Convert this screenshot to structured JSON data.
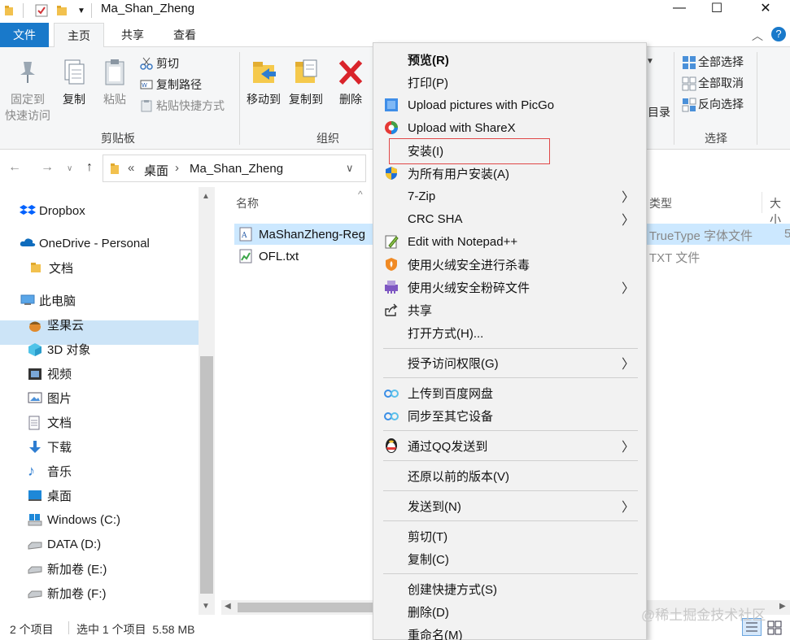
{
  "window": {
    "title": "Ma_Shan_Zheng",
    "controls": {
      "minimize": "—",
      "maximize": "☐",
      "close": "✕"
    }
  },
  "ribbon_tabs": [
    "文件",
    "主页",
    "共享",
    "查看"
  ],
  "ribbon": {
    "clipboard": {
      "pin": "固定到",
      "pin2": "快速访问",
      "copy": "复制",
      "paste": "粘贴",
      "cut": "剪切",
      "copy_path": "复制路径",
      "paste_shortcut": "粘贴快捷方式",
      "group": "剪贴板"
    },
    "organize": {
      "move_to": "移动到",
      "copy_to": "复制到",
      "delete": "删除",
      "group": "组织"
    },
    "open_partial": "目录",
    "select": {
      "select_all": "全部选择",
      "select_none": "全部取消",
      "invert": "反向选择",
      "group": "选择"
    }
  },
  "address": {
    "prefix": "«",
    "crumb1": "桌面",
    "sep": "›",
    "crumb2": "Ma_Shan_Zheng"
  },
  "sidebar": {
    "items": [
      {
        "label": "Dropbox"
      },
      {
        "label": "OneDrive - Personal"
      },
      {
        "label": "文档"
      },
      {
        "label": "此电脑"
      },
      {
        "label": "坚果云"
      },
      {
        "label": "3D 对象"
      },
      {
        "label": "视频"
      },
      {
        "label": "图片"
      },
      {
        "label": "文档"
      },
      {
        "label": "下载"
      },
      {
        "label": "音乐"
      },
      {
        "label": "桌面"
      },
      {
        "label": "Windows (C:)"
      },
      {
        "label": "DATA (D:)"
      },
      {
        "label": "新加卷 (E:)"
      },
      {
        "label": "新加卷 (F:)"
      }
    ]
  },
  "content": {
    "headers": {
      "name": "名称",
      "type": "类型",
      "size": "大小"
    },
    "rows": [
      {
        "name": "MaShanZheng-Reg",
        "type": "TrueType 字体文件",
        "size": "5"
      },
      {
        "name": "OFL.txt",
        "type": "TXT 文件",
        "size": ""
      }
    ]
  },
  "status": {
    "count": "2 个项目",
    "selection": "选中 1 个项目  5.58 MB"
  },
  "context_menu": {
    "items": [
      {
        "label": "预览(R)"
      },
      {
        "label": "打印(P)"
      },
      {
        "label": "Upload pictures with PicGo"
      },
      {
        "label": "Upload with ShareX"
      },
      {
        "label": "安装(I)"
      },
      {
        "label": "为所有用户安装(A)"
      },
      {
        "label": "7-Zip"
      },
      {
        "label": "CRC SHA"
      },
      {
        "label": "Edit with Notepad++"
      },
      {
        "label": "使用火绒安全进行杀毒"
      },
      {
        "label": "使用火绒安全粉碎文件"
      },
      {
        "label": "共享"
      },
      {
        "label": "打开方式(H)..."
      },
      {
        "label": "授予访问权限(G)"
      },
      {
        "label": "上传到百度网盘"
      },
      {
        "label": "同步至其它设备"
      },
      {
        "label": "通过QQ发送到"
      },
      {
        "label": "还原以前的版本(V)"
      },
      {
        "label": "发送到(N)"
      },
      {
        "label": "剪切(T)"
      },
      {
        "label": "复制(C)"
      },
      {
        "label": "创建快捷方式(S)"
      },
      {
        "label": "删除(D)"
      },
      {
        "label": "重命名(M)"
      }
    ]
  },
  "watermark": "@稀土掘金技术社区"
}
